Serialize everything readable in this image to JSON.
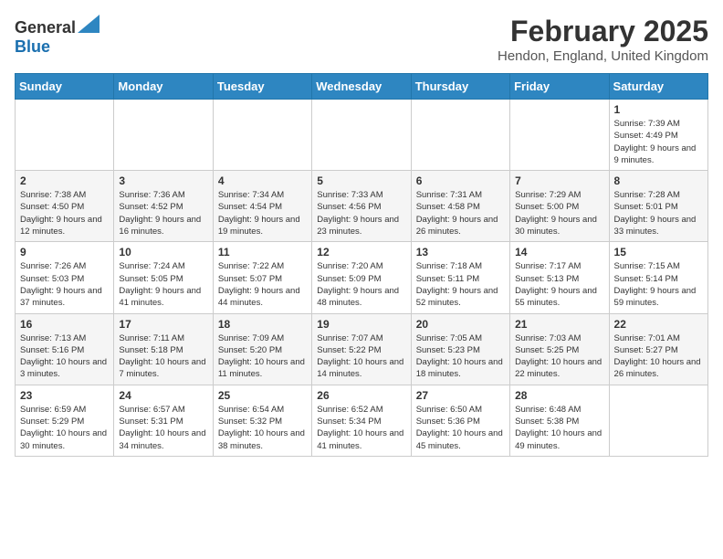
{
  "header": {
    "logo_general": "General",
    "logo_blue": "Blue",
    "month": "February 2025",
    "location": "Hendon, England, United Kingdom"
  },
  "weekdays": [
    "Sunday",
    "Monday",
    "Tuesday",
    "Wednesday",
    "Thursday",
    "Friday",
    "Saturday"
  ],
  "weeks": [
    [
      {
        "day": "",
        "info": ""
      },
      {
        "day": "",
        "info": ""
      },
      {
        "day": "",
        "info": ""
      },
      {
        "day": "",
        "info": ""
      },
      {
        "day": "",
        "info": ""
      },
      {
        "day": "",
        "info": ""
      },
      {
        "day": "1",
        "info": "Sunrise: 7:39 AM\nSunset: 4:49 PM\nDaylight: 9 hours and 9 minutes."
      }
    ],
    [
      {
        "day": "2",
        "info": "Sunrise: 7:38 AM\nSunset: 4:50 PM\nDaylight: 9 hours and 12 minutes."
      },
      {
        "day": "3",
        "info": "Sunrise: 7:36 AM\nSunset: 4:52 PM\nDaylight: 9 hours and 16 minutes."
      },
      {
        "day": "4",
        "info": "Sunrise: 7:34 AM\nSunset: 4:54 PM\nDaylight: 9 hours and 19 minutes."
      },
      {
        "day": "5",
        "info": "Sunrise: 7:33 AM\nSunset: 4:56 PM\nDaylight: 9 hours and 23 minutes."
      },
      {
        "day": "6",
        "info": "Sunrise: 7:31 AM\nSunset: 4:58 PM\nDaylight: 9 hours and 26 minutes."
      },
      {
        "day": "7",
        "info": "Sunrise: 7:29 AM\nSunset: 5:00 PM\nDaylight: 9 hours and 30 minutes."
      },
      {
        "day": "8",
        "info": "Sunrise: 7:28 AM\nSunset: 5:01 PM\nDaylight: 9 hours and 33 minutes."
      }
    ],
    [
      {
        "day": "9",
        "info": "Sunrise: 7:26 AM\nSunset: 5:03 PM\nDaylight: 9 hours and 37 minutes."
      },
      {
        "day": "10",
        "info": "Sunrise: 7:24 AM\nSunset: 5:05 PM\nDaylight: 9 hours and 41 minutes."
      },
      {
        "day": "11",
        "info": "Sunrise: 7:22 AM\nSunset: 5:07 PM\nDaylight: 9 hours and 44 minutes."
      },
      {
        "day": "12",
        "info": "Sunrise: 7:20 AM\nSunset: 5:09 PM\nDaylight: 9 hours and 48 minutes."
      },
      {
        "day": "13",
        "info": "Sunrise: 7:18 AM\nSunset: 5:11 PM\nDaylight: 9 hours and 52 minutes."
      },
      {
        "day": "14",
        "info": "Sunrise: 7:17 AM\nSunset: 5:13 PM\nDaylight: 9 hours and 55 minutes."
      },
      {
        "day": "15",
        "info": "Sunrise: 7:15 AM\nSunset: 5:14 PM\nDaylight: 9 hours and 59 minutes."
      }
    ],
    [
      {
        "day": "16",
        "info": "Sunrise: 7:13 AM\nSunset: 5:16 PM\nDaylight: 10 hours and 3 minutes."
      },
      {
        "day": "17",
        "info": "Sunrise: 7:11 AM\nSunset: 5:18 PM\nDaylight: 10 hours and 7 minutes."
      },
      {
        "day": "18",
        "info": "Sunrise: 7:09 AM\nSunset: 5:20 PM\nDaylight: 10 hours and 11 minutes."
      },
      {
        "day": "19",
        "info": "Sunrise: 7:07 AM\nSunset: 5:22 PM\nDaylight: 10 hours and 14 minutes."
      },
      {
        "day": "20",
        "info": "Sunrise: 7:05 AM\nSunset: 5:23 PM\nDaylight: 10 hours and 18 minutes."
      },
      {
        "day": "21",
        "info": "Sunrise: 7:03 AM\nSunset: 5:25 PM\nDaylight: 10 hours and 22 minutes."
      },
      {
        "day": "22",
        "info": "Sunrise: 7:01 AM\nSunset: 5:27 PM\nDaylight: 10 hours and 26 minutes."
      }
    ],
    [
      {
        "day": "23",
        "info": "Sunrise: 6:59 AM\nSunset: 5:29 PM\nDaylight: 10 hours and 30 minutes."
      },
      {
        "day": "24",
        "info": "Sunrise: 6:57 AM\nSunset: 5:31 PM\nDaylight: 10 hours and 34 minutes."
      },
      {
        "day": "25",
        "info": "Sunrise: 6:54 AM\nSunset: 5:32 PM\nDaylight: 10 hours and 38 minutes."
      },
      {
        "day": "26",
        "info": "Sunrise: 6:52 AM\nSunset: 5:34 PM\nDaylight: 10 hours and 41 minutes."
      },
      {
        "day": "27",
        "info": "Sunrise: 6:50 AM\nSunset: 5:36 PM\nDaylight: 10 hours and 45 minutes."
      },
      {
        "day": "28",
        "info": "Sunrise: 6:48 AM\nSunset: 5:38 PM\nDaylight: 10 hours and 49 minutes."
      },
      {
        "day": "",
        "info": ""
      }
    ]
  ]
}
